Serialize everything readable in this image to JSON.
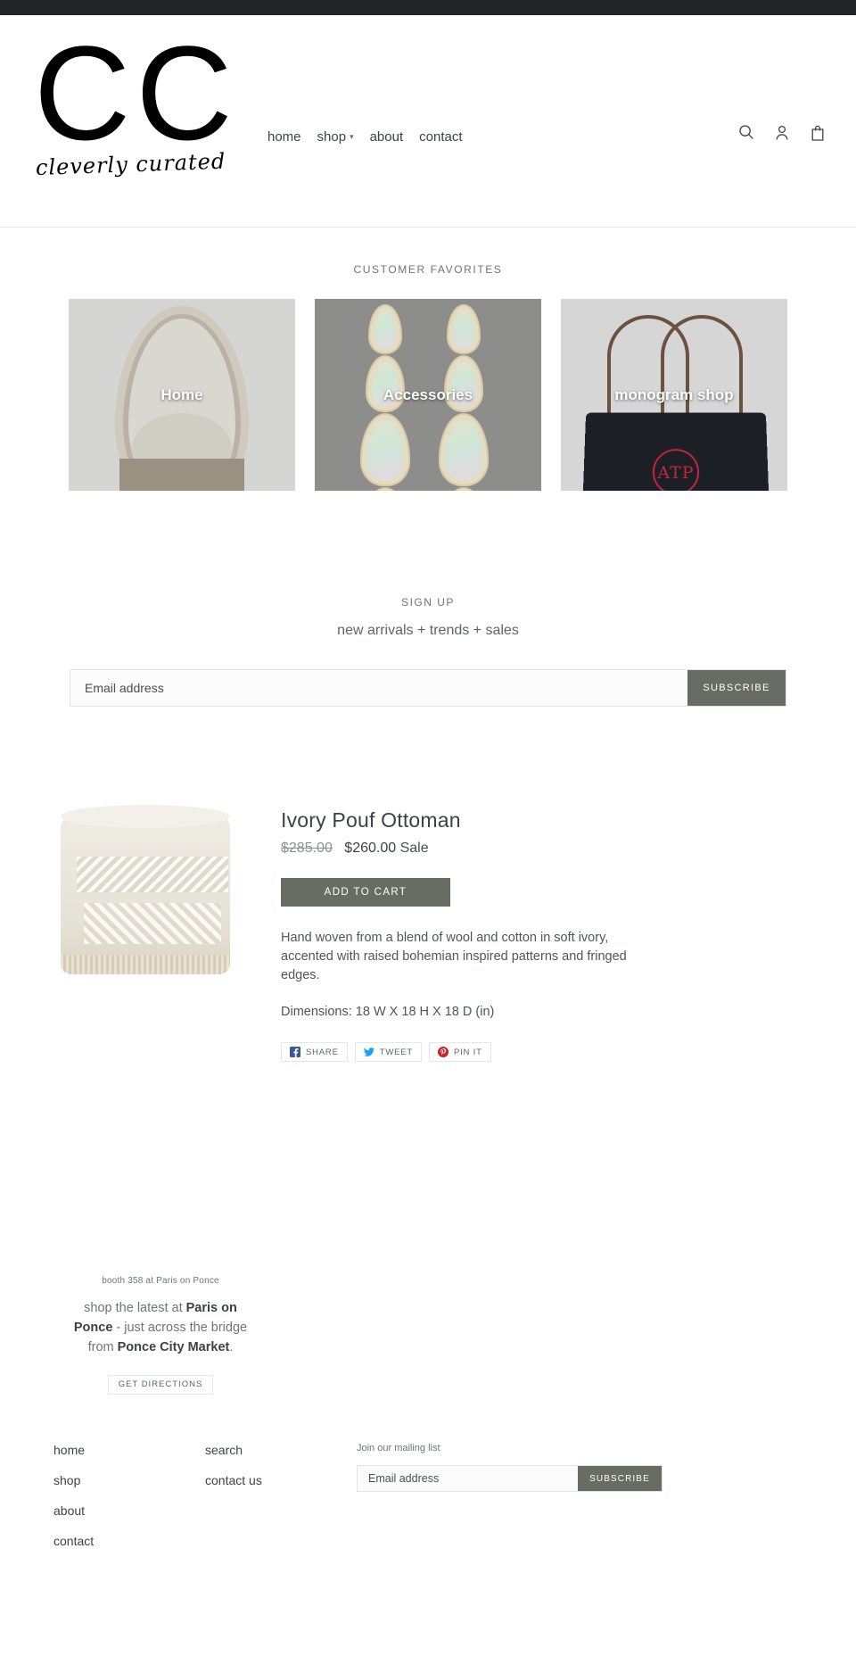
{
  "header": {
    "logo_mark": "CC",
    "logo_script": "cleverly curated",
    "nav": [
      {
        "label": "home",
        "has_dropdown": false
      },
      {
        "label": "shop",
        "has_dropdown": true
      },
      {
        "label": "about",
        "has_dropdown": false
      },
      {
        "label": "contact",
        "has_dropdown": false
      }
    ],
    "icons": [
      {
        "name": "search-icon",
        "label": "Search"
      },
      {
        "name": "account-icon",
        "label": "Log in"
      },
      {
        "name": "cart-icon",
        "label": "Cart"
      }
    ]
  },
  "favorites": {
    "title": "CUSTOMER FAVORITES",
    "cards": [
      {
        "label": "Home"
      },
      {
        "label": "Accessories"
      },
      {
        "label": "monogram shop"
      }
    ]
  },
  "signup": {
    "kicker": "SIGN UP",
    "subtitle": "new arrivals + trends + sales",
    "email_placeholder": "Email address",
    "email_value": "",
    "button_label": "SUBSCRIBE"
  },
  "product": {
    "title": "Ivory Pouf Ottoman",
    "price_original": "$285.00",
    "price_sale": "$260.00",
    "sale_tag": "Sale",
    "add_to_cart_label": "ADD TO CART",
    "description": "Hand woven from a blend of wool and cotton in soft ivory, accented with raised bohemian inspired patterns and fringed edges.",
    "dimensions": "Dimensions: 18 W X 18 H X 18 D (in)",
    "share": [
      {
        "label": "SHARE",
        "network": "facebook",
        "color": "#3b5998"
      },
      {
        "label": "TWEET",
        "network": "twitter",
        "color": "#1da1f2"
      },
      {
        "label": "PIN IT",
        "network": "pinterest",
        "color": "#cb2027"
      }
    ]
  },
  "store": {
    "booth": "booth 358 at Paris on Ponce",
    "line_parts": [
      {
        "text": "shop the latest at ",
        "bold": false
      },
      {
        "text": "Paris on Ponce",
        "bold": true
      },
      {
        "text": " - just across the bridge from ",
        "bold": false
      },
      {
        "text": "Ponce City Market",
        "bold": true
      },
      {
        "text": ".",
        "bold": false
      }
    ],
    "directions_label": "GET DIRECTIONS"
  },
  "footer": {
    "col1": [
      "home",
      "shop",
      "about",
      "contact"
    ],
    "col2": [
      "search",
      "contact us"
    ],
    "newsletter": {
      "heading": "Join our mailing list",
      "email_placeholder": "Email address",
      "email_value": "",
      "button_label": "SUBSCRIBE"
    }
  },
  "colors": {
    "accent": "#676d63",
    "announce_bar": "#21252a",
    "text": "#3d4246",
    "muted": "#6f7478"
  }
}
